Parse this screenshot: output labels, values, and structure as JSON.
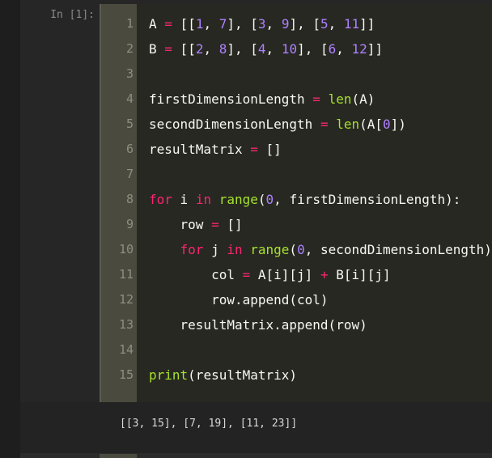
{
  "cell": {
    "prompt": "In [1]:",
    "lines": [
      {
        "no": "1",
        "tokens": [
          [
            "id",
            "A"
          ],
          [
            "pn",
            " "
          ],
          [
            "op",
            "="
          ],
          [
            "pn",
            " [["
          ],
          [
            "num",
            "1"
          ],
          [
            "pn",
            ", "
          ],
          [
            "num",
            "7"
          ],
          [
            "pn",
            "], ["
          ],
          [
            "num",
            "3"
          ],
          [
            "pn",
            ", "
          ],
          [
            "num",
            "9"
          ],
          [
            "pn",
            "], ["
          ],
          [
            "num",
            "5"
          ],
          [
            "pn",
            ", "
          ],
          [
            "num",
            "11"
          ],
          [
            "pn",
            "]]"
          ]
        ]
      },
      {
        "no": "2",
        "tokens": [
          [
            "id",
            "B"
          ],
          [
            "pn",
            " "
          ],
          [
            "op",
            "="
          ],
          [
            "pn",
            " [["
          ],
          [
            "num",
            "2"
          ],
          [
            "pn",
            ", "
          ],
          [
            "num",
            "8"
          ],
          [
            "pn",
            "], ["
          ],
          [
            "num",
            "4"
          ],
          [
            "pn",
            ", "
          ],
          [
            "num",
            "10"
          ],
          [
            "pn",
            "], ["
          ],
          [
            "num",
            "6"
          ],
          [
            "pn",
            ", "
          ],
          [
            "num",
            "12"
          ],
          [
            "pn",
            "]]"
          ]
        ]
      },
      {
        "no": "3",
        "tokens": []
      },
      {
        "no": "4",
        "tokens": [
          [
            "id",
            "firstDimensionLength"
          ],
          [
            "pn",
            " "
          ],
          [
            "op",
            "="
          ],
          [
            "pn",
            " "
          ],
          [
            "fn",
            "len"
          ],
          [
            "pn",
            "(A)"
          ]
        ]
      },
      {
        "no": "5",
        "tokens": [
          [
            "id",
            "secondDimensionLength"
          ],
          [
            "pn",
            " "
          ],
          [
            "op",
            "="
          ],
          [
            "pn",
            " "
          ],
          [
            "fn",
            "len"
          ],
          [
            "pn",
            "(A["
          ],
          [
            "num",
            "0"
          ],
          [
            "pn",
            "])"
          ]
        ]
      },
      {
        "no": "6",
        "tokens": [
          [
            "id",
            "resultMatrix"
          ],
          [
            "pn",
            " "
          ],
          [
            "op",
            "="
          ],
          [
            "pn",
            " []"
          ]
        ]
      },
      {
        "no": "7",
        "tokens": []
      },
      {
        "no": "8",
        "tokens": [
          [
            "kw",
            "for"
          ],
          [
            "pn",
            " i "
          ],
          [
            "kw",
            "in"
          ],
          [
            "pn",
            " "
          ],
          [
            "fn",
            "range"
          ],
          [
            "pn",
            "("
          ],
          [
            "num",
            "0"
          ],
          [
            "pn",
            ", firstDimensionLength):"
          ]
        ]
      },
      {
        "no": "9",
        "tokens": [
          [
            "pn",
            "    row "
          ],
          [
            "op",
            "="
          ],
          [
            "pn",
            " []"
          ]
        ]
      },
      {
        "no": "10",
        "tokens": [
          [
            "pn",
            "    "
          ],
          [
            "kw",
            "for"
          ],
          [
            "pn",
            " j "
          ],
          [
            "kw",
            "in"
          ],
          [
            "pn",
            " "
          ],
          [
            "fn",
            "range"
          ],
          [
            "pn",
            "("
          ],
          [
            "num",
            "0"
          ],
          [
            "pn",
            ", secondDimensionLength):"
          ]
        ]
      },
      {
        "no": "11",
        "tokens": [
          [
            "pn",
            "        col "
          ],
          [
            "op",
            "="
          ],
          [
            "pn",
            " A[i][j] "
          ],
          [
            "op",
            "+"
          ],
          [
            "pn",
            " B[i][j]"
          ]
        ]
      },
      {
        "no": "12",
        "tokens": [
          [
            "pn",
            "        row.append(col)"
          ]
        ]
      },
      {
        "no": "13",
        "tokens": [
          [
            "pn",
            "    resultMatrix.append(row)"
          ]
        ]
      },
      {
        "no": "14",
        "tokens": []
      },
      {
        "no": "15",
        "tokens": [
          [
            "fn",
            "print"
          ],
          [
            "pn",
            "(resultMatrix)"
          ]
        ]
      }
    ]
  },
  "output": {
    "text": "[[3, 15], [7, 19], [11, 23]]"
  },
  "colors": {
    "keyword": "#f92672",
    "operator": "#f92672",
    "number": "#ae81ff",
    "builtin": "#a6e22e",
    "text": "#f8f8f2"
  }
}
